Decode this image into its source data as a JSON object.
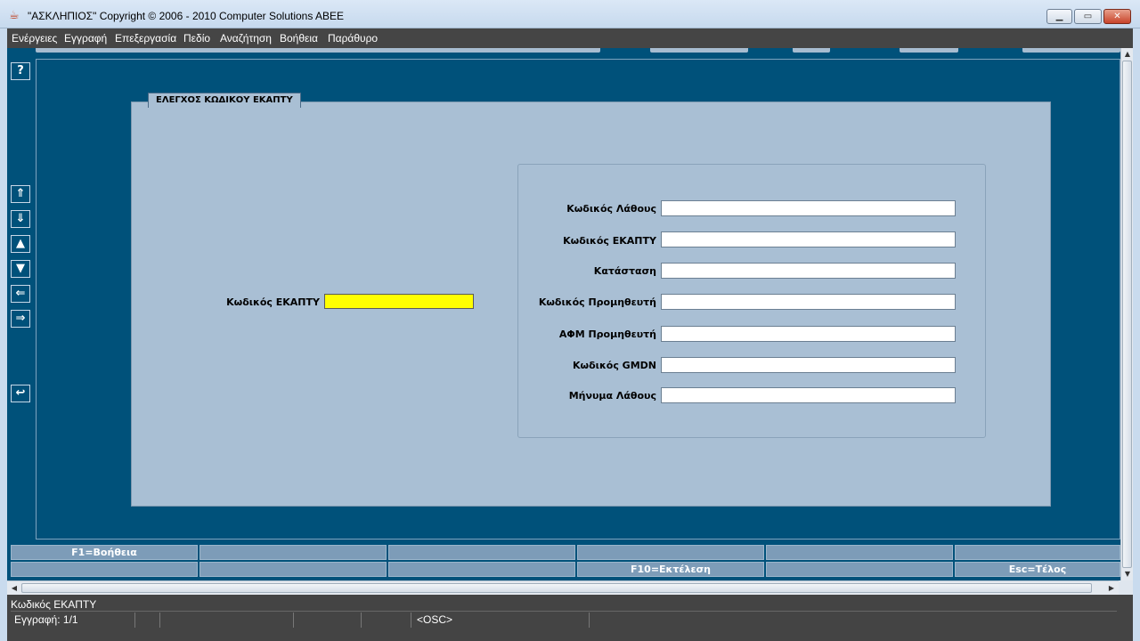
{
  "window": {
    "title": "\"ΑΣΚΛΗΠΙΟΣ\" Copyright © 2006 - 2010 Computer Solutions ABEE",
    "app_icon": "java-cup-icon",
    "controls": {
      "minimize": "minimize-icon",
      "maximize": "maximize-icon",
      "close": "close-icon"
    }
  },
  "menu": {
    "items": [
      {
        "label": "Ενέργειες"
      },
      {
        "label": "Εγγραφή"
      },
      {
        "label": "Επεξεργασία"
      },
      {
        "label": "Πεδίο"
      },
      {
        "label": "Αναζήτηση"
      },
      {
        "label": "Βοήθεια"
      },
      {
        "label": "Παράθυρο"
      }
    ]
  },
  "toolbar": {
    "tools": [
      {
        "name": "help",
        "icon": "help-icon",
        "glyph": "?"
      },
      {
        "name": "first-record",
        "icon": "arrow-up-bar-icon",
        "glyph": "⇑"
      },
      {
        "name": "last-record",
        "icon": "arrow-down-bar-icon",
        "glyph": "⇓"
      },
      {
        "name": "previous-record",
        "icon": "triangle-up-icon",
        "glyph": "▲"
      },
      {
        "name": "next-record",
        "icon": "triangle-down-icon",
        "glyph": "▼"
      },
      {
        "name": "previous-block",
        "icon": "arrow-left-icon",
        "glyph": "⇐"
      },
      {
        "name": "next-block",
        "icon": "arrow-right-icon",
        "glyph": "⇒"
      },
      {
        "name": "undo",
        "icon": "undo-icon",
        "glyph": "↩"
      }
    ]
  },
  "panel": {
    "title": "ΕΛΕΓΧΟΣ ΚΩΔΙΚΟΥ ΕΚΑΠΤΥ",
    "input_label": "Κωδικός ΕΚΑΠΤΥ",
    "input_value": "",
    "input_color": "#ffff00",
    "fields": [
      {
        "label": "Κωδικός Λάθους",
        "value": ""
      },
      {
        "label": "Κωδικός ΕΚΑΠΤΥ",
        "value": ""
      },
      {
        "label": "Κατάσταση",
        "value": ""
      },
      {
        "label": "Κωδικός Προμηθευτή",
        "value": ""
      },
      {
        "label": "ΑΦΜ Προμηθευτή",
        "value": ""
      },
      {
        "label": "Κωδικός GMDN",
        "value": ""
      },
      {
        "label": "Μήνυμα Λάθους",
        "value": ""
      }
    ]
  },
  "function_keys": {
    "row1": [
      "F1=Βοήθεια",
      "",
      "",
      "",
      "",
      ""
    ],
    "row2": [
      "",
      "",
      "",
      "F10=Εκτέλεση",
      "",
      "Esc=Τέλος"
    ]
  },
  "status": {
    "hint": "Κωδικός ΕΚΑΠΤΥ",
    "record": "Εγγραφή: 1/1",
    "mode": "<OSC>"
  },
  "colors": {
    "workspace": "#00517a",
    "panel": "#a9bfd4",
    "menubar": "#454545",
    "fkey": "#7d9cb8"
  }
}
